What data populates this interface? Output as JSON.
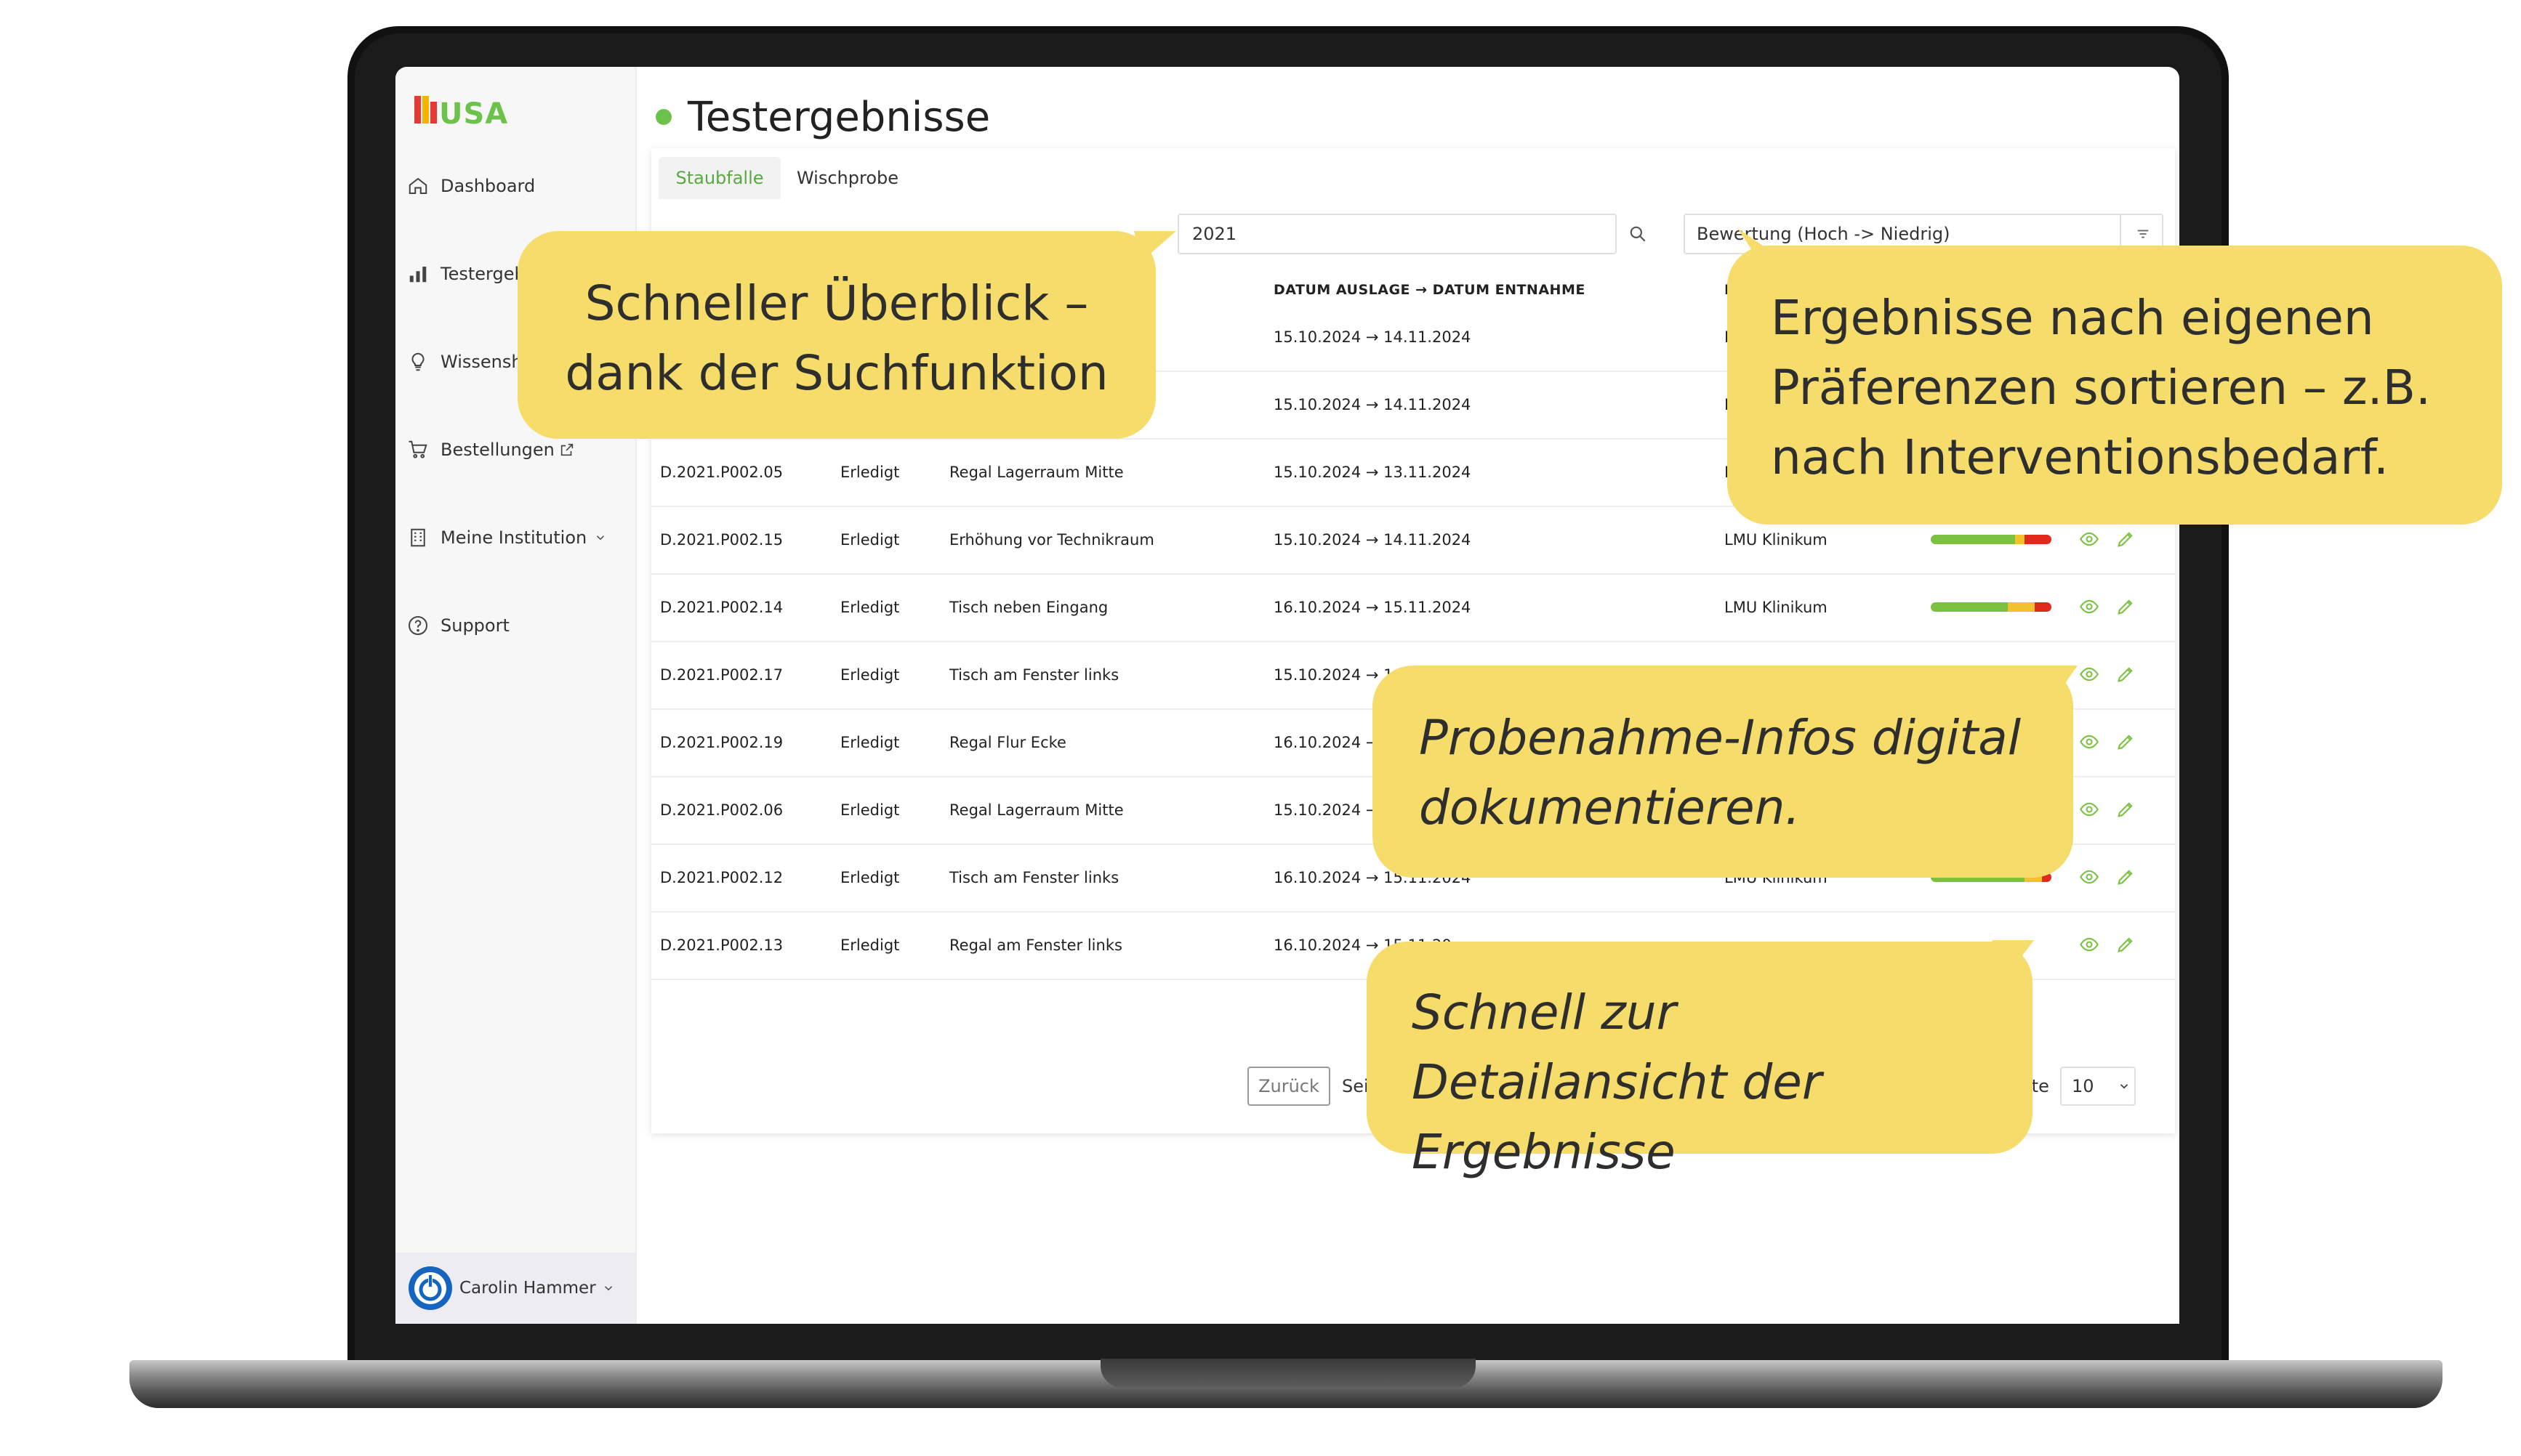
{
  "app": {
    "logo_text": "MUSA",
    "page_title": "Testergebnisse"
  },
  "sidebar": {
    "items": [
      {
        "label": "Dashboard",
        "icon": "home-icon"
      },
      {
        "label": "Testergeb",
        "icon": "bar-chart-icon"
      },
      {
        "label": "Wissensh",
        "icon": "lightbulb-icon"
      },
      {
        "label": "Bestellungen",
        "icon": "cart-icon"
      },
      {
        "label": "Meine Institution",
        "icon": "building-icon"
      },
      {
        "label": "Support",
        "icon": "help-circle-icon"
      }
    ],
    "user": {
      "name": "Carolin Hammer"
    }
  },
  "tabs": [
    {
      "label": "Staubfalle",
      "active": true
    },
    {
      "label": "Wischprobe",
      "active": false
    }
  ],
  "search": {
    "value": "2021"
  },
  "sort": {
    "value": "Bewertung (Hoch -> Niedrig)"
  },
  "table": {
    "headers": {
      "date": "DATUM AUSLAGE → DATUM ENTNAHME",
      "location_partial": "LA"
    },
    "rows": [
      {
        "id": "",
        "status": "",
        "place": "",
        "date": "15.10.2024 → 14.11.2024",
        "location": "LMU",
        "bar": [
          0,
          0,
          0
        ]
      },
      {
        "id": "",
        "status": "",
        "place": "",
        "date": "15.10.2024 → 14.11.2024",
        "location": "LM",
        "bar": [
          0,
          0,
          0
        ]
      },
      {
        "id": "D.2021.P002.05",
        "status": "Erledigt",
        "place": "Regal Lagerraum Mitte",
        "date": "15.10.2024 → 13.11.2024",
        "location": "LM",
        "bar": [
          0,
          0,
          0
        ]
      },
      {
        "id": "D.2021.P002.15",
        "status": "Erledigt",
        "place": "Erhöhung vor Technikraum",
        "date": "15.10.2024 → 14.11.2024",
        "location": "LMU Klinikum",
        "bar": [
          0.7,
          0.08,
          0.22
        ]
      },
      {
        "id": "D.2021.P002.14",
        "status": "Erledigt",
        "place": "Tisch neben Eingang",
        "date": "16.10.2024 → 15.11.2024",
        "location": "LMU Klinikum",
        "bar": [
          0.64,
          0.22,
          0.14
        ]
      },
      {
        "id": "D.2021.P002.17",
        "status": "Erledigt",
        "place": "Tisch am Fenster links",
        "date": "15.10.2024 → 14.11.20",
        "location": "",
        "bar": [
          0,
          0,
          0
        ]
      },
      {
        "id": "D.2021.P002.19",
        "status": "Erledigt",
        "place": "Regal Flur Ecke",
        "date": "16.10.2024 → 15",
        "location": "",
        "bar": [
          0,
          0,
          0
        ]
      },
      {
        "id": "D.2021.P002.06",
        "status": "Erledigt",
        "place": "Regal Lagerraum Mitte",
        "date": "15.10.2024 → 13",
        "location": "",
        "bar": [
          0,
          0,
          0
        ]
      },
      {
        "id": "D.2021.P002.12",
        "status": "Erledigt",
        "place": "Tisch am Fenster links",
        "date": "16.10.2024 → 15.11.2024",
        "location": "LMU Klinikum",
        "bar": [
          0.78,
          0.14,
          0.08
        ]
      },
      {
        "id": "D.2021.P002.13",
        "status": "Erledigt",
        "place": "Regal am Fenster links",
        "date": "16.10.2024 → 15.11.20",
        "location": "",
        "bar": [
          0,
          0,
          0
        ]
      }
    ]
  },
  "pagination": {
    "back_label": "Zurück",
    "page_label_partial": "Seit",
    "per_page_label": "Seite",
    "per_page_value": "10"
  },
  "bubbles": {
    "search": "Schneller Überblick – dank der Suchfunktion",
    "sort": "Ergebnisse nach eigenen Präferenzen sortieren – z.B. nach Interventionsbedarf.",
    "document": "Probenahme-Infos digital dokumentieren.",
    "detail": "Schnell zur Detailansicht der Ergebnisse"
  },
  "colors": {
    "accent_green": "#6cc24a",
    "bubble_yellow": "#f6dc6a",
    "bar_green": "#7cc242",
    "bar_yellow": "#f2c12e",
    "bar_red": "#e02a1d"
  }
}
